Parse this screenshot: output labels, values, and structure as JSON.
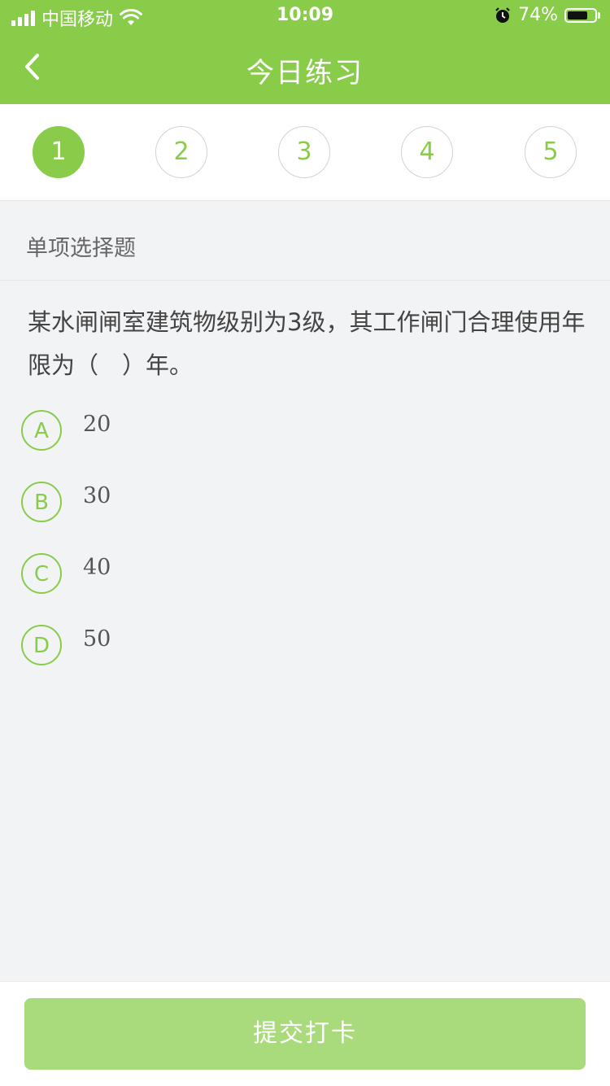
{
  "status_bar": {
    "carrier": "中国移动",
    "time": "10:09",
    "battery": "74%",
    "battery_level": 0.74
  },
  "nav": {
    "title": "今日练习",
    "back_icon": "chevron-left-icon"
  },
  "steps": [
    "1",
    "2",
    "3",
    "4",
    "5"
  ],
  "active_step": 1,
  "section": {
    "label": "单项选择题"
  },
  "question": {
    "text": "某水闸闸室建筑物级别为3级，其工作闸门合理使用年限为（　）年。",
    "options": [
      {
        "letter": "A",
        "text": "20"
      },
      {
        "letter": "B",
        "text": "30"
      },
      {
        "letter": "C",
        "text": "40"
      },
      {
        "letter": "D",
        "text": "50"
      }
    ]
  },
  "footer": {
    "submit_label": "提交打卡"
  },
  "colors": {
    "accent": "#88cc4a",
    "submit_disabled": "#a9da7c",
    "background": "#f2f3f5"
  }
}
